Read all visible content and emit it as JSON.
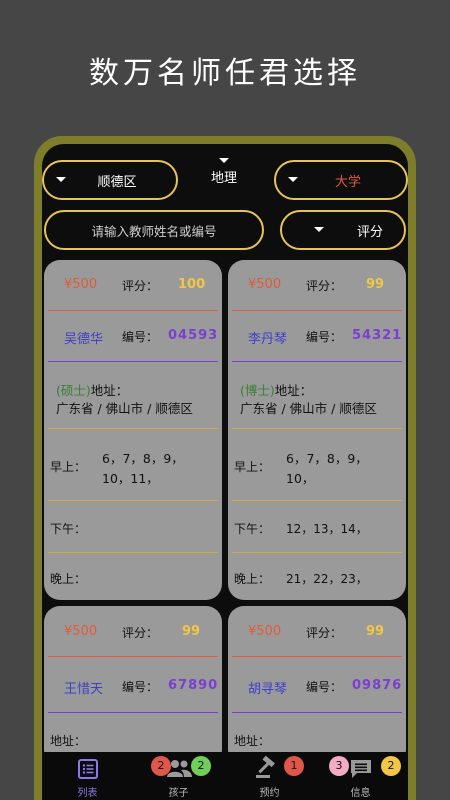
{
  "headline": "数万名师任君选择",
  "filters": {
    "district": "顺德区",
    "subject": "地理",
    "level": "大学",
    "search_placeholder": "请输入教师姓名或编号",
    "sort": "评分"
  },
  "labels": {
    "score": "评分：",
    "number": "编号：",
    "address": "地址：",
    "morning": "早上：",
    "afternoon": "下午：",
    "evening": "晚上："
  },
  "cards": [
    {
      "price": "¥500",
      "score": "100",
      "name": "吴德华",
      "number": "04593",
      "degree": "(硕士)",
      "address": "广东省 / 佛山市 / 顺德区",
      "morning_line1": "6，7，8，9，",
      "morning_line2": "10，11，",
      "afternoon": "",
      "evening": ""
    },
    {
      "price": "¥500",
      "score": "99",
      "name": "李丹琴",
      "number": "54321",
      "degree": "(博士)",
      "address": "广东省 / 佛山市 / 顺德区",
      "morning_line1": "6，7，8，9，",
      "morning_line2": "10，",
      "afternoon": "12，13，14，",
      "evening": "21，22，23，"
    },
    {
      "price": "¥500",
      "score": "99",
      "name": "王惜天",
      "number": "67890"
    },
    {
      "price": "¥500",
      "score": "99",
      "name": "胡寻琴",
      "number": "09876"
    }
  ],
  "tabs": [
    {
      "label": "列表",
      "icon": "list-icon",
      "badges": []
    },
    {
      "label": "孩子",
      "icon": "people-icon",
      "badges": [
        "2",
        "2"
      ]
    },
    {
      "label": "预约",
      "icon": "gavel-icon",
      "badges": [
        "1"
      ]
    },
    {
      "label": "信息",
      "icon": "message-icon",
      "badges": [
        "3",
        "2"
      ]
    }
  ],
  "colors": {
    "background": "#464646",
    "frame": "#7d7d2a",
    "accent": "#e6c45a",
    "price": "#e25a3b",
    "score": "#f2c744",
    "active_tab": "#8c78e8"
  }
}
